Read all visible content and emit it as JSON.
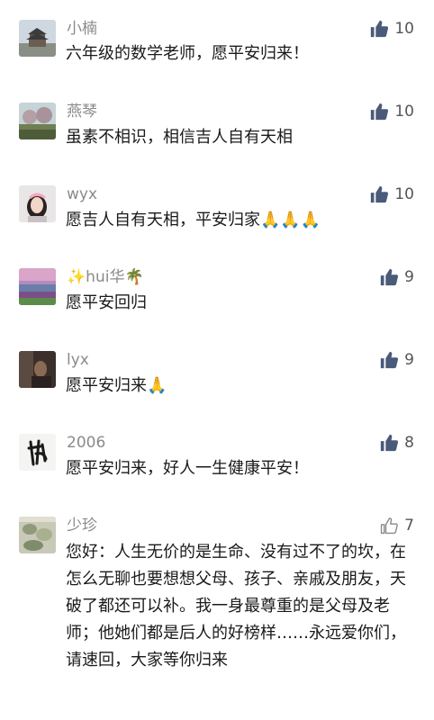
{
  "comments": [
    {
      "user": "小楠",
      "text": "六年级的数学老师，愿平安归来！",
      "likes": "10",
      "liked": true
    },
    {
      "user": "燕琴",
      "text": "虽素不相识，相信吉人自有天相",
      "likes": "10",
      "liked": true
    },
    {
      "user": "wyx",
      "text": "愿吉人自有天相，平安归家",
      "likes": "10",
      "liked": true,
      "emoji": "🙏🙏🙏"
    },
    {
      "user": "hui华",
      "user_prefix_emoji": "✨",
      "user_suffix_emoji": "🌴",
      "text": "愿平安回归",
      "likes": "9",
      "liked": true
    },
    {
      "user": "lyx",
      "text": "愿平安归来",
      "likes": "9",
      "liked": true,
      "emoji": "🙏"
    },
    {
      "user": "2006",
      "text": "愿平安归来，好人一生健康平安！",
      "likes": "8",
      "liked": true
    },
    {
      "user": "少珍",
      "text": "您好：人生无价的是生命、没有过不了的坎，在怎么无聊也要想想父母、孩子、亲戚及朋友，天破了都还可以补。我一身最尊重的是父母及老师；他她们都是后人的好榜样……永远爱你们，请速回，大家等你归来",
      "likes": "7",
      "liked": false
    }
  ],
  "colors": {
    "like_active": "#4a5a7a",
    "like_inactive": "#8a8a8a",
    "username": "#8a8a8a",
    "text": "#1a1a1a"
  },
  "icons": {
    "like": "thumbs-up-icon"
  }
}
